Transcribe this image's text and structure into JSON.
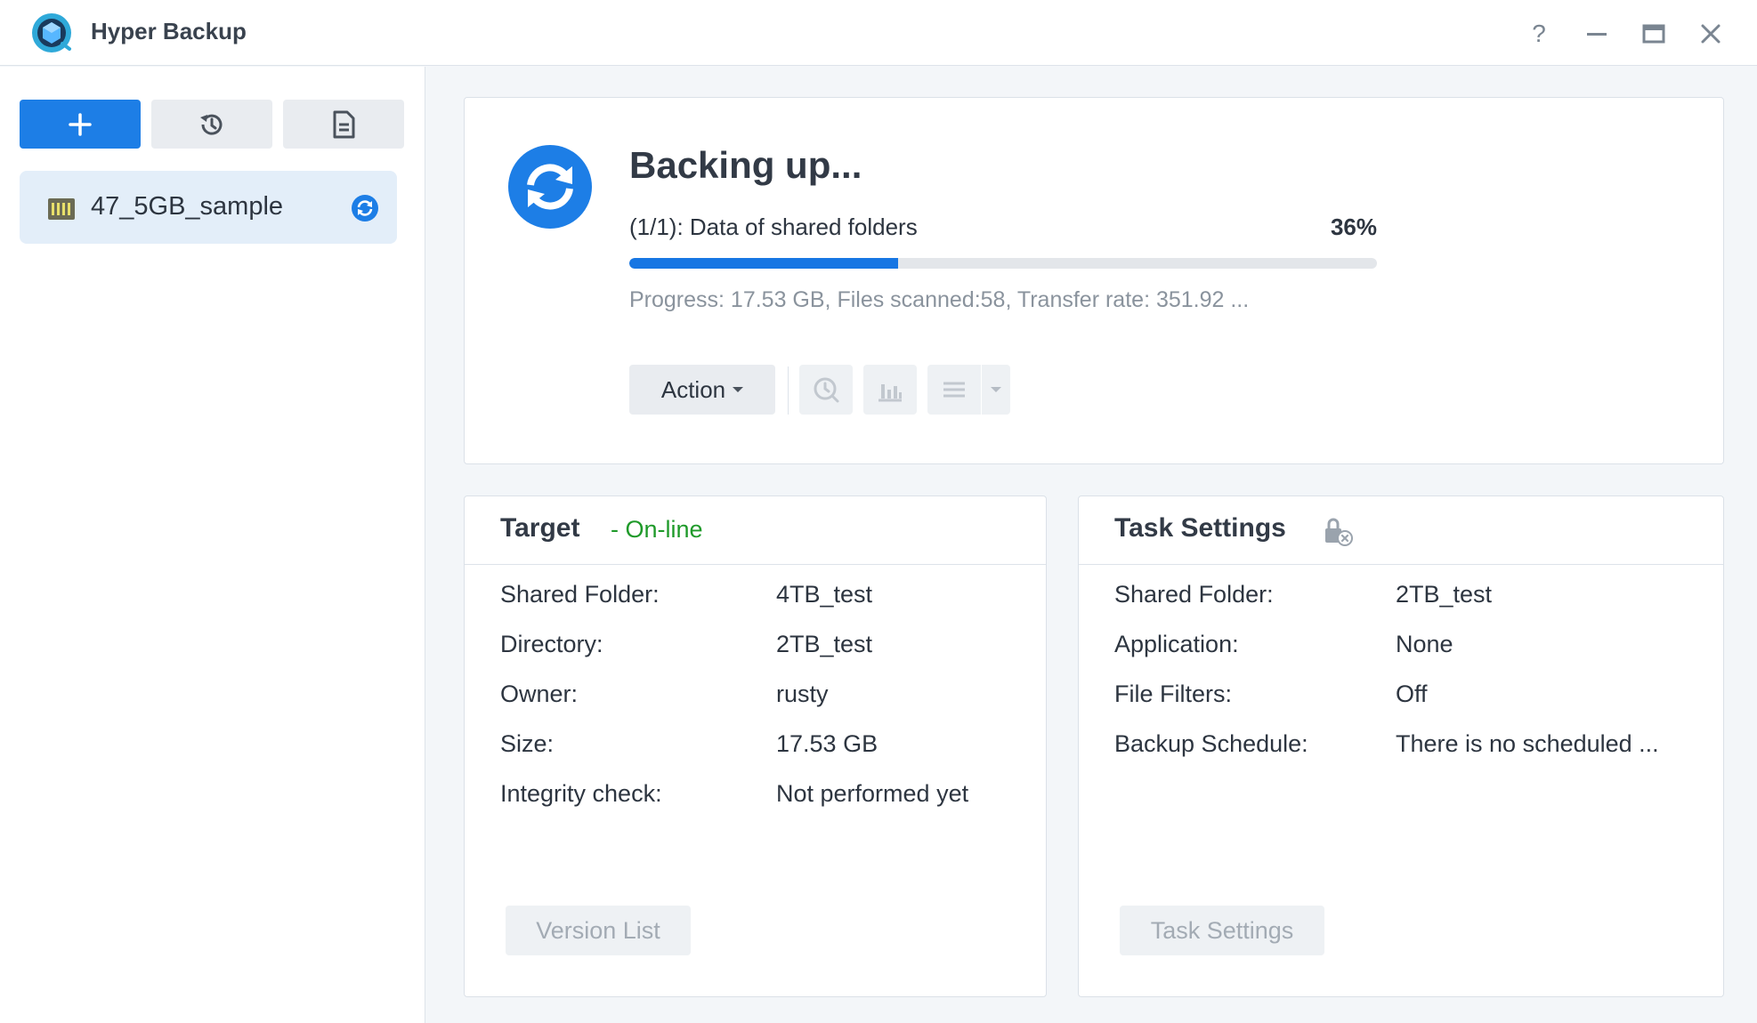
{
  "app": {
    "title": "Hyper Backup",
    "logo_icon": "hyper-backup-logo-icon"
  },
  "window_controls": {
    "help": "?",
    "help_icon": "question-icon",
    "minimize_icon": "minimize-icon",
    "maximize_icon": "maximize-icon",
    "close_icon": "close-icon"
  },
  "sidebar": {
    "buttons": [
      {
        "icon": "plus-icon"
      },
      {
        "icon": "history-icon"
      },
      {
        "icon": "log-document-icon"
      }
    ],
    "tasks": [
      {
        "name": "47_5GB_sample",
        "icon": "nas-device-icon",
        "status_icon": "syncing-icon",
        "selected": true
      }
    ]
  },
  "status": {
    "title": "Backing up...",
    "stage": "(1/1): Data of shared folders",
    "percent_label": "36%",
    "progress_fraction": 0.36,
    "detail": "Progress: 17.53 GB, Files scanned:58, Transfer rate: 351.92 ...",
    "action_label": "Action",
    "toolbar_icons": [
      "restore-clock-icon",
      "statistics-chart-icon",
      "list-menu-icon",
      "chevron-down-icon"
    ]
  },
  "target": {
    "title": "Target",
    "status": "- On-line",
    "rows": [
      {
        "label": "Shared Folder:",
        "value": "4TB_test"
      },
      {
        "label": "Directory:",
        "value": "2TB_test"
      },
      {
        "label": "Owner:",
        "value": "rusty"
      },
      {
        "label": "Size:",
        "value": "17.53 GB"
      },
      {
        "label": "Integrity check:",
        "value": "Not performed yet"
      }
    ],
    "button_label": "Version List"
  },
  "task_settings": {
    "title": "Task Settings",
    "lock_icon": "encryption-lock-icon",
    "rows": [
      {
        "label": "Shared Folder:",
        "value": "2TB_test"
      },
      {
        "label": "Application:",
        "value": "None"
      },
      {
        "label": "File Filters:",
        "value": "Off"
      },
      {
        "label": "Backup Schedule:",
        "value": "There is no scheduled ..."
      }
    ],
    "button_label": "Task Settings"
  },
  "colors": {
    "accent": "#1d7ee6",
    "online": "#1f9a2a",
    "progress_track": "#e3e6ea"
  }
}
